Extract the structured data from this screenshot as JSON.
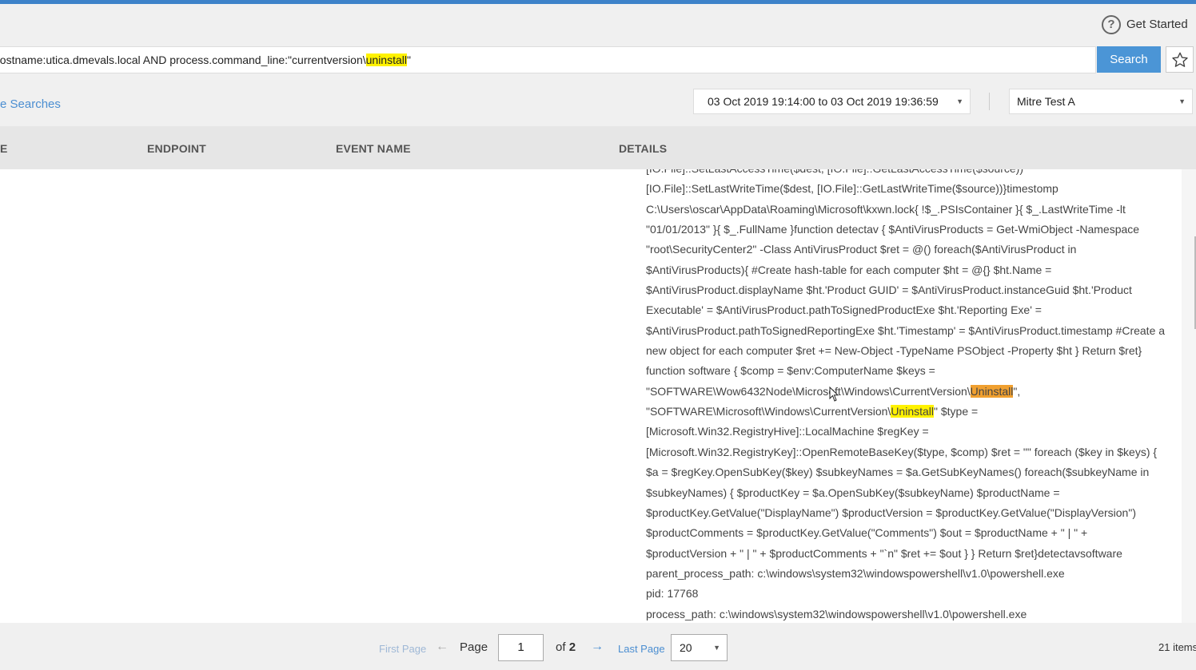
{
  "header": {
    "help_icon": "question-circle-icon",
    "get_started": "Get Started"
  },
  "search": {
    "query_prefix": "hostname:utica.dmevals.local AND process.command_line:\"currentversion\\",
    "query_highlight": "uninstall",
    "query_suffix": "\"",
    "button": "Search",
    "star_icon": "star-icon"
  },
  "filters": {
    "saved_searches_link": "e Searches",
    "date_range": "03 Oct 2019 19:14:00 to 03 Oct 2019 19:36:59",
    "tenant": "Mitre Test A"
  },
  "table": {
    "columns": [
      "E",
      "ENDPOINT",
      "EVENT NAME",
      "DETAILS"
    ]
  },
  "details": {
    "lines": [
      "[IO.File]::SetLastAccessTime($dest, [IO.File]::GetLastAccessTime($source))",
      "[IO.File]::SetLastWriteTime($dest, [IO.File]::GetLastWriteTime($source))}timestomp",
      "C:\\Users\\oscar\\AppData\\Roaming\\Microsoft\\kxwn.lock{ !$_.PSIsContainer }{ $_.LastWriteTime -lt",
      "\"01/01/2013\" }{ $_.FullName }function detectav { $AntiVirusProducts = Get-WmiObject -Namespace",
      "\"root\\SecurityCenter2\" -Class AntiVirusProduct $ret = @() foreach($AntiVirusProduct in",
      "$AntiVirusProducts){ #Create hash-table for each computer $ht = @{} $ht.Name =",
      "$AntiVirusProduct.displayName $ht.'Product GUID' = $AntiVirusProduct.instanceGuid $ht.'Product",
      "Executable' = $AntiVirusProduct.pathToSignedProductExe $ht.'Reporting Exe' =",
      "$AntiVirusProduct.pathToSignedReportingExe $ht.'Timestamp' = $AntiVirusProduct.timestamp #Create a",
      "new object for each computer $ret += New-Object -TypeName PSObject -Property $ht } Return $ret}",
      "function software { $comp = $env:ComputerName $keys ="
    ],
    "wow_line_prefix": "\"SOFTWARE\\Wow6432Node\\Microsoft\\Windows\\CurrentVersion\\",
    "wow_line_highlight": "Uninstall",
    "wow_line_suffix": "\",",
    "ms_line_prefix": "\"SOFTWARE\\Microsoft\\Windows\\CurrentVersion\\",
    "ms_line_highlight": "Uninstall",
    "ms_line_suffix": "\" $type =",
    "lines_after": [
      "[Microsoft.Win32.RegistryHive]::LocalMachine $regKey =",
      "[Microsoft.Win32.RegistryKey]::OpenRemoteBaseKey($type, $comp) $ret = \"\" foreach ($key in $keys) {",
      "$a = $regKey.OpenSubKey($key) $subkeyNames = $a.GetSubKeyNames() foreach($subkeyName in",
      "$subkeyNames) { $productKey = $a.OpenSubKey($subkeyName) $productName =",
      "$productKey.GetValue(\"DisplayName\") $productVersion = $productKey.GetValue(\"DisplayVersion\")",
      "$productComments = $productKey.GetValue(\"Comments\") $out = $productName + \" | \" +",
      "$productVersion + \" | \" + $productComments + \"`n\" $ret += $out } } Return $ret}detectavsoftware",
      "parent_process_path:  c:\\windows\\system32\\windowspowershell\\v1.0\\powershell.exe",
      "pid:  17768",
      "process_path:  c:\\windows\\system32\\windowspowershell\\v1.0\\powershell.exe"
    ]
  },
  "pagination": {
    "first_page": "First Page",
    "prev_arrow": "←",
    "page_label": "Page",
    "page_value": "1",
    "of_label": "of",
    "total_pages": "2",
    "next_arrow": "→",
    "last_page": "Last Page",
    "page_size": "20",
    "items_count": "21 items"
  }
}
